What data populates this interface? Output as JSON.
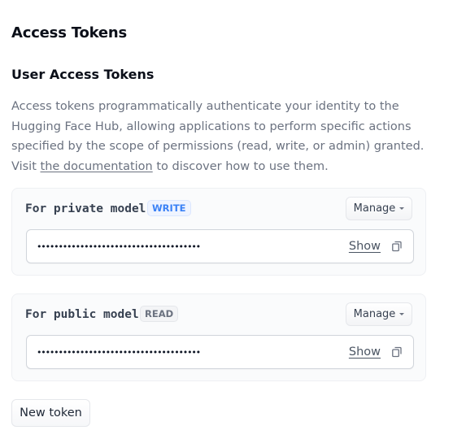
{
  "page": {
    "title": "Access Tokens"
  },
  "section": {
    "title": "User Access Tokens",
    "description_before": "Access tokens programmatically authenticate your identity to the Hugging Face Hub, allowing applications to perform specific actions specified by the scope of permissions (read, write, or admin) granted. Visit ",
    "link_text": "the documentation",
    "description_after": " to discover how to use them."
  },
  "tokens": [
    {
      "name": "For private model",
      "role": "WRITE",
      "manage_label": "Manage",
      "masked_value": "••••••••••••••••••••••••••••••••••••••",
      "show_label": "Show",
      "copy_icon": "copy-icon"
    },
    {
      "name": "For public model",
      "role": "READ",
      "manage_label": "Manage",
      "masked_value": "••••••••••••••••••••••••••••••••••••••",
      "show_label": "Show",
      "copy_icon": "copy-icon"
    }
  ],
  "new_token_label": "New token",
  "colors": {
    "write_badge": "#3b82f6",
    "read_badge": "#6b7280",
    "text_muted": "#6b7280"
  }
}
